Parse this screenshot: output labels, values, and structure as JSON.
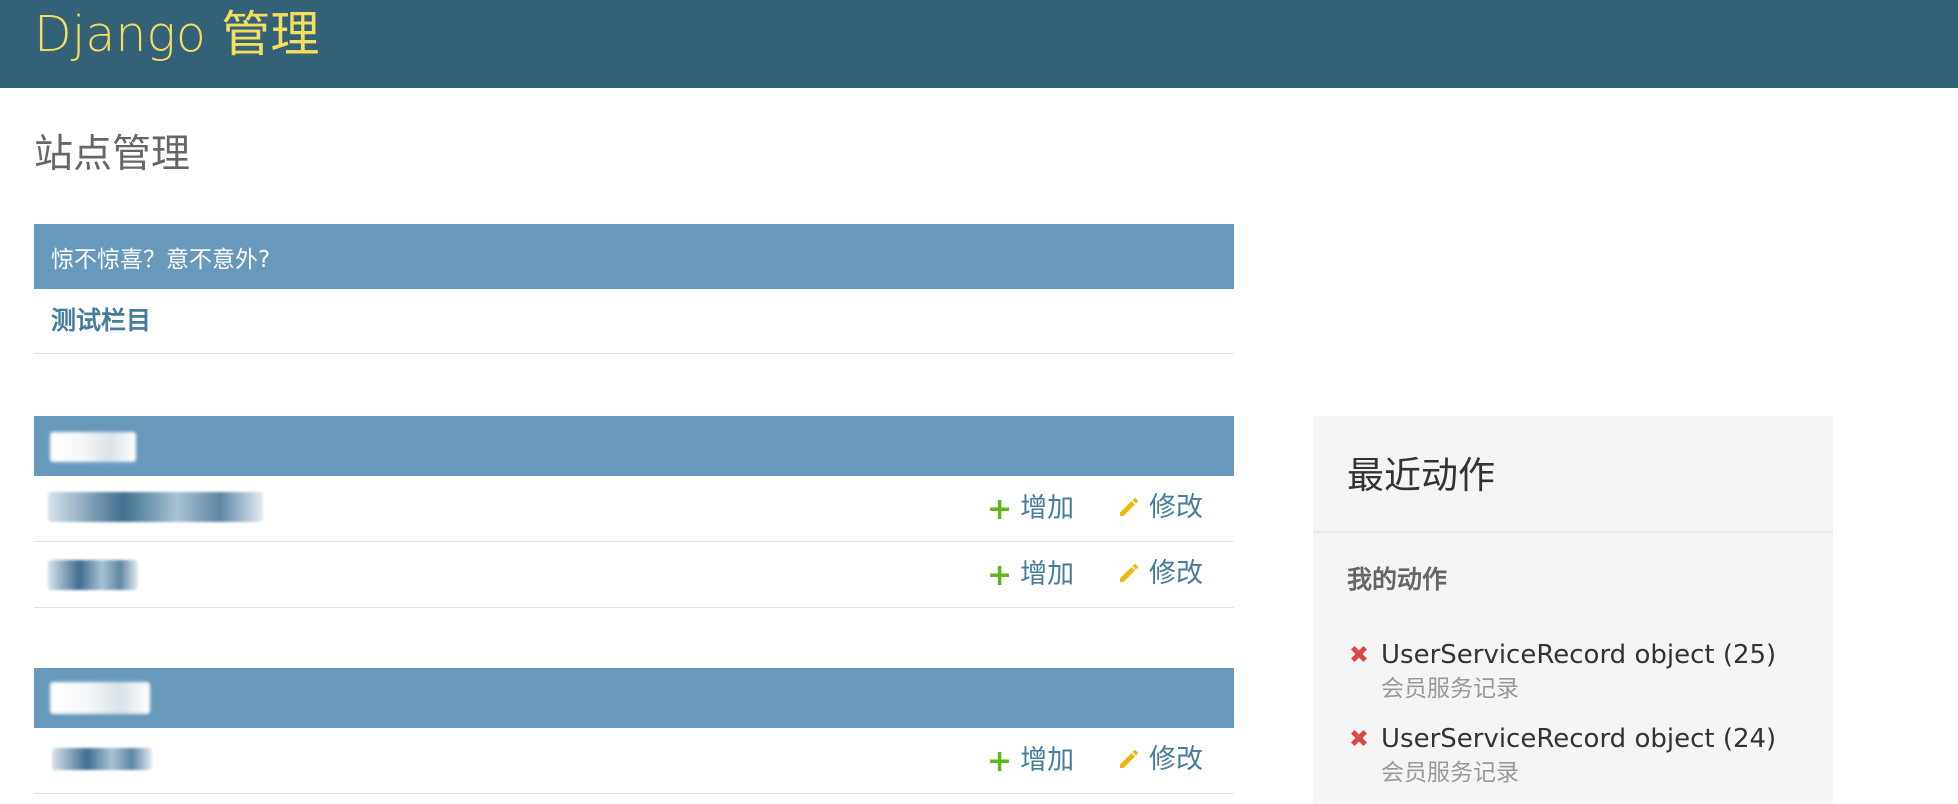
{
  "header": {
    "branding": "Django 管理"
  },
  "page": {
    "title": "站点管理"
  },
  "modules": [
    {
      "caption": "惊不惊喜？意不意外?",
      "rows": [
        {
          "label": "测试栏目"
        }
      ]
    },
    {
      "caption": "",
      "rows": [
        {
          "label": "",
          "add": "增加",
          "change": "修改"
        },
        {
          "label": "",
          "add": "增加",
          "change": "修改"
        }
      ]
    },
    {
      "caption": "",
      "rows": [
        {
          "label": "",
          "add": "增加",
          "change": "修改"
        }
      ]
    }
  ],
  "recent_actions": {
    "title": "最近动作",
    "subtitle": "我的动作",
    "items": [
      {
        "name": "UserServiceRecord object (25)",
        "type": "会员服务记录",
        "status": "deleted"
      },
      {
        "name": "UserServiceRecord object (24)",
        "type": "会员服务记录",
        "status": "deleted"
      }
    ]
  },
  "colors": {
    "header_bg": "#336178",
    "branding": "#f5dd5d",
    "module_caption_bg": "#6699bb",
    "link": "#447e9b",
    "add_icon": "#5fb51c",
    "change_icon": "#efb80b",
    "delete_icon": "#dd4646"
  },
  "icons": {
    "add": "plus-icon",
    "change": "pencil-icon",
    "delete": "x-icon"
  }
}
